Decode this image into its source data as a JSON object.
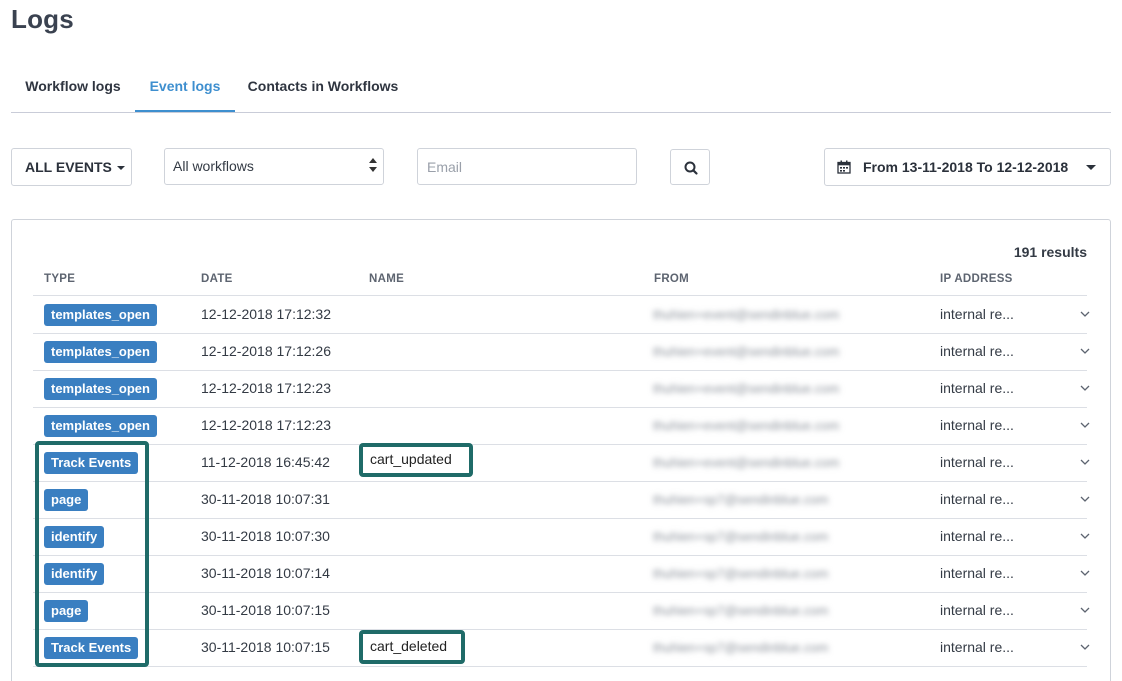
{
  "page_title": "Logs",
  "tabs": [
    {
      "label": "Workflow logs",
      "active": false
    },
    {
      "label": "Event logs",
      "active": true
    },
    {
      "label": "Contacts in Workflows",
      "active": false
    }
  ],
  "filters": {
    "events_label": "ALL EVENTS",
    "workflow_selected": "All workflows",
    "email_placeholder": "Email",
    "date_range": "From 13-11-2018 To 12-12-2018"
  },
  "results_label": "191 results",
  "columns": [
    "TYPE",
    "DATE",
    "NAME",
    "FROM",
    "IP ADDRESS"
  ],
  "rows": [
    {
      "type": "templates_open",
      "date": "12-12-2018 17:12:32",
      "name": "",
      "from": "thuhien+event@sendinblue.com",
      "ip": "internal re..."
    },
    {
      "type": "templates_open",
      "date": "12-12-2018 17:12:26",
      "name": "",
      "from": "thuhien+event@sendinblue.com",
      "ip": "internal re..."
    },
    {
      "type": "templates_open",
      "date": "12-12-2018 17:12:23",
      "name": "",
      "from": "thuhien+event@sendinblue.com",
      "ip": "internal re..."
    },
    {
      "type": "templates_open",
      "date": "12-12-2018 17:12:23",
      "name": "",
      "from": "thuhien+event@sendinblue.com",
      "ip": "internal re..."
    },
    {
      "type": "Track Events",
      "date": "11-12-2018 16:45:42",
      "name": "cart_updated",
      "from": "thuhien+event@sendinblue.com",
      "ip": "internal re..."
    },
    {
      "type": "page",
      "date": "30-11-2018 10:07:31",
      "name": "",
      "from": "thuhien+sp7@sendinblue.com",
      "ip": "internal re..."
    },
    {
      "type": "identify",
      "date": "30-11-2018 10:07:30",
      "name": "",
      "from": "thuhien+sp7@sendinblue.com",
      "ip": "internal re..."
    },
    {
      "type": "identify",
      "date": "30-11-2018 10:07:14",
      "name": "",
      "from": "thuhien+sp7@sendinblue.com",
      "ip": "internal re..."
    },
    {
      "type": "page",
      "date": "30-11-2018 10:07:15",
      "name": "",
      "from": "thuhien+sp7@sendinblue.com",
      "ip": "internal re..."
    },
    {
      "type": "Track Events",
      "date": "30-11-2018 10:07:15",
      "name": "cart_deleted",
      "from": "thuhien+sp7@sendinblue.com",
      "ip": "internal re..."
    }
  ],
  "colors": {
    "accent": "#3e8fcf",
    "badge": "#3a7fc1",
    "highlight": "#1f6b68"
  }
}
